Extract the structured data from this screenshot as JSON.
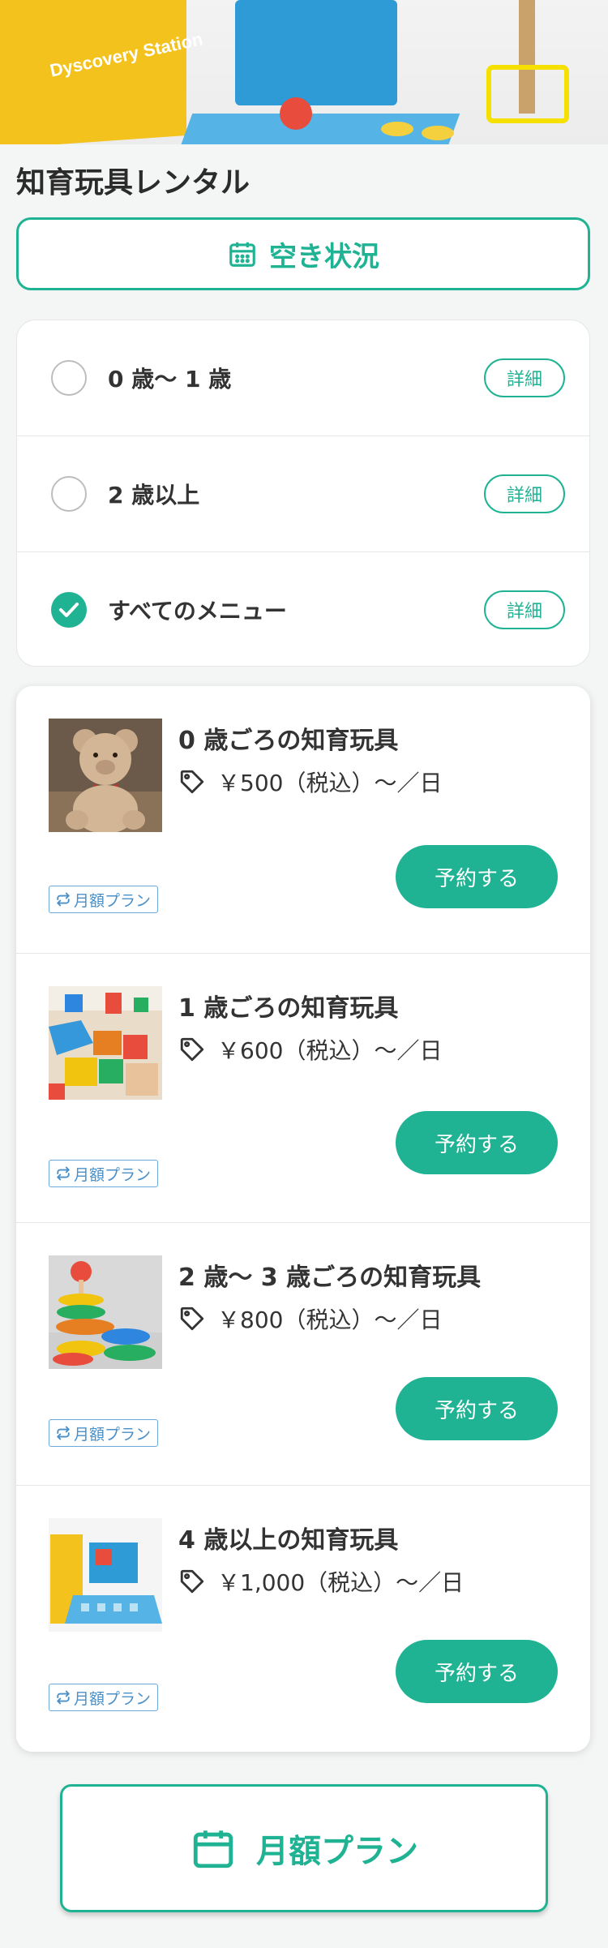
{
  "hero": {
    "box_text": "Dyscovery Station"
  },
  "page": {
    "title": "知育玩具レンタル"
  },
  "availability_button": {
    "label": "空き状況",
    "icon": "calendar-icon"
  },
  "filters": [
    {
      "label": "0 歳〜 1 歳",
      "checked": false,
      "detail_label": "詳細"
    },
    {
      "label": "2 歳以上",
      "checked": false,
      "detail_label": "詳細"
    },
    {
      "label": "すべてのメニュー",
      "checked": true,
      "detail_label": "詳細"
    }
  ],
  "products": [
    {
      "name": "0 歳ごろの知育玩具",
      "price": "￥500（税込）〜／日",
      "book_label": "予約する",
      "plan_badge": "月額プラン",
      "image": "teddy-bear"
    },
    {
      "name": "1 歳ごろの知育玩具",
      "price": "￥600（税込）〜／日",
      "book_label": "予約する",
      "plan_badge": "月額プラン",
      "image": "building-blocks"
    },
    {
      "name": "2 歳〜 3 歳ごろの知育玩具",
      "price": "￥800（税込）〜／日",
      "book_label": "予約する",
      "plan_badge": "月額プラン",
      "image": "stacking-toy"
    },
    {
      "name": "4 歳以上の知育玩具",
      "price": "￥1,000（税込）〜／日",
      "book_label": "予約する",
      "plan_badge": "月額プラン",
      "image": "discovery-kit"
    }
  ],
  "monthly_plan_button": {
    "label": "月額プラン",
    "icon": "calendar-icon"
  },
  "colors": {
    "accent": "#1fb394",
    "badge": "#4a90c8",
    "text": "#333333"
  }
}
